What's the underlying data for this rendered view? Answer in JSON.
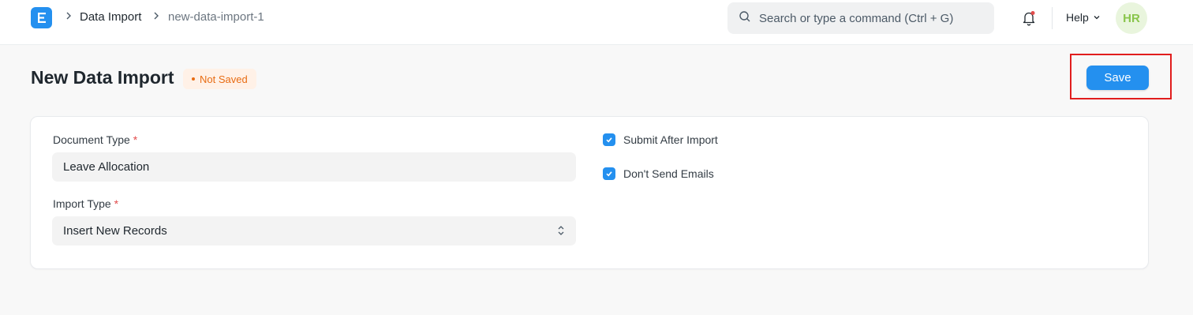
{
  "breadcrumbs": [
    {
      "label": "Data Import"
    },
    {
      "label": "new-data-import-1"
    }
  ],
  "search": {
    "placeholder": "Search or type a command (Ctrl + G)"
  },
  "navbar": {
    "help_label": "Help",
    "avatar_initials": "HR"
  },
  "page": {
    "title": "New Data Import",
    "status_badge": "Not Saved",
    "save_label": "Save"
  },
  "form": {
    "document_type": {
      "label": "Document Type",
      "required_mark": "*",
      "value": "Leave Allocation"
    },
    "import_type": {
      "label": "Import Type",
      "required_mark": "*",
      "value": "Insert New Records"
    },
    "submit_after_import": {
      "label": "Submit After Import",
      "checked": true
    },
    "dont_send_emails": {
      "label": "Don't Send Emails",
      "checked": true
    }
  },
  "colors": {
    "accent": "#2490ef",
    "badge_text": "#e86c13",
    "highlight": "#e11d1d"
  }
}
